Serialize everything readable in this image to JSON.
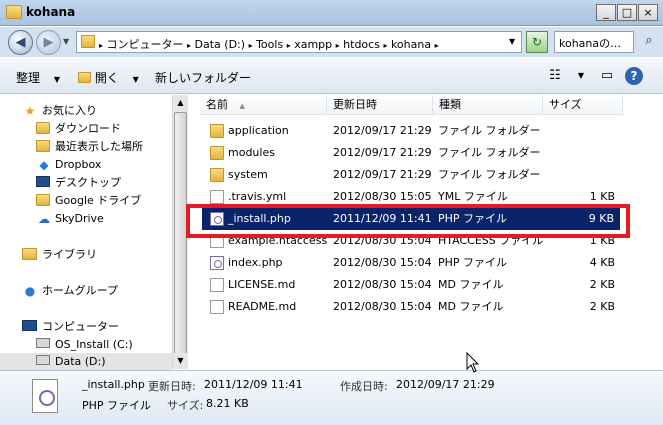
{
  "window": {
    "title": "kohana",
    "controls": [
      "_",
      "□",
      "×"
    ]
  },
  "address": {
    "crumbs": [
      "コンピューター",
      "Data (D:)",
      "Tools",
      "xampp",
      "htdocs",
      "kohana"
    ],
    "search_placeholder": "kohanaの…"
  },
  "toolbar": {
    "organize": "整理",
    "open": "開く",
    "new_folder": "新しいフォルダー"
  },
  "nav": {
    "favorites": "お気に入り",
    "downloads": "ダウンロード",
    "recent": "最近表示した場所",
    "dropbox": "Dropbox",
    "desktop": "デスクトップ",
    "google_drive": "Google ドライブ",
    "skydrive": "SkyDrive",
    "libraries": "ライブラリ",
    "homegroup": "ホームグループ",
    "computer": "コンピューター",
    "os_install": "OS_Install (C:)",
    "data_drive": "Data (D:)"
  },
  "columns": {
    "name": "名前",
    "modified": "更新日時",
    "type": "種類",
    "size": "サイズ"
  },
  "files": [
    {
      "name": "application",
      "modified": "2012/09/17 21:29",
      "type": "ファイル フォルダー",
      "size": "",
      "icon": "folder"
    },
    {
      "name": "modules",
      "modified": "2012/09/17 21:29",
      "type": "ファイル フォルダー",
      "size": "",
      "icon": "folder"
    },
    {
      "name": "system",
      "modified": "2012/09/17 21:29",
      "type": "ファイル フォルダー",
      "size": "",
      "icon": "folder"
    },
    {
      "name": ".travis.yml",
      "modified": "2012/08/30 15:05",
      "type": "YML ファイル",
      "size": "1 KB",
      "icon": "file"
    },
    {
      "name": "_install.php",
      "modified": "2011/12/09 11:41",
      "type": "PHP ファイル",
      "size": "9 KB",
      "icon": "php"
    },
    {
      "name": "example.htaccess",
      "modified": "2012/08/30 15:04",
      "type": "HTACCESS ファイル",
      "size": "1 KB",
      "icon": "file"
    },
    {
      "name": "index.php",
      "modified": "2012/08/30 15:04",
      "type": "PHP ファイル",
      "size": "4 KB",
      "icon": "php"
    },
    {
      "name": "LICENSE.md",
      "modified": "2012/08/30 15:04",
      "type": "MD ファイル",
      "size": "2 KB",
      "icon": "file"
    },
    {
      "name": "README.md",
      "modified": "2012/08/30 15:04",
      "type": "MD ファイル",
      "size": "2 KB",
      "icon": "file"
    }
  ],
  "details": {
    "filename": "_install.php",
    "modified_label": "更新日時:",
    "modified_value": "2011/12/09 11:41",
    "created_label": "作成日時:",
    "created_value": "2012/09/17 21:29",
    "type": "PHP ファイル",
    "size_label": "サイズ:",
    "size_value": "8.21 KB"
  },
  "colors": {
    "selection": "#0a246a",
    "highlight_border": "#e41b23"
  }
}
